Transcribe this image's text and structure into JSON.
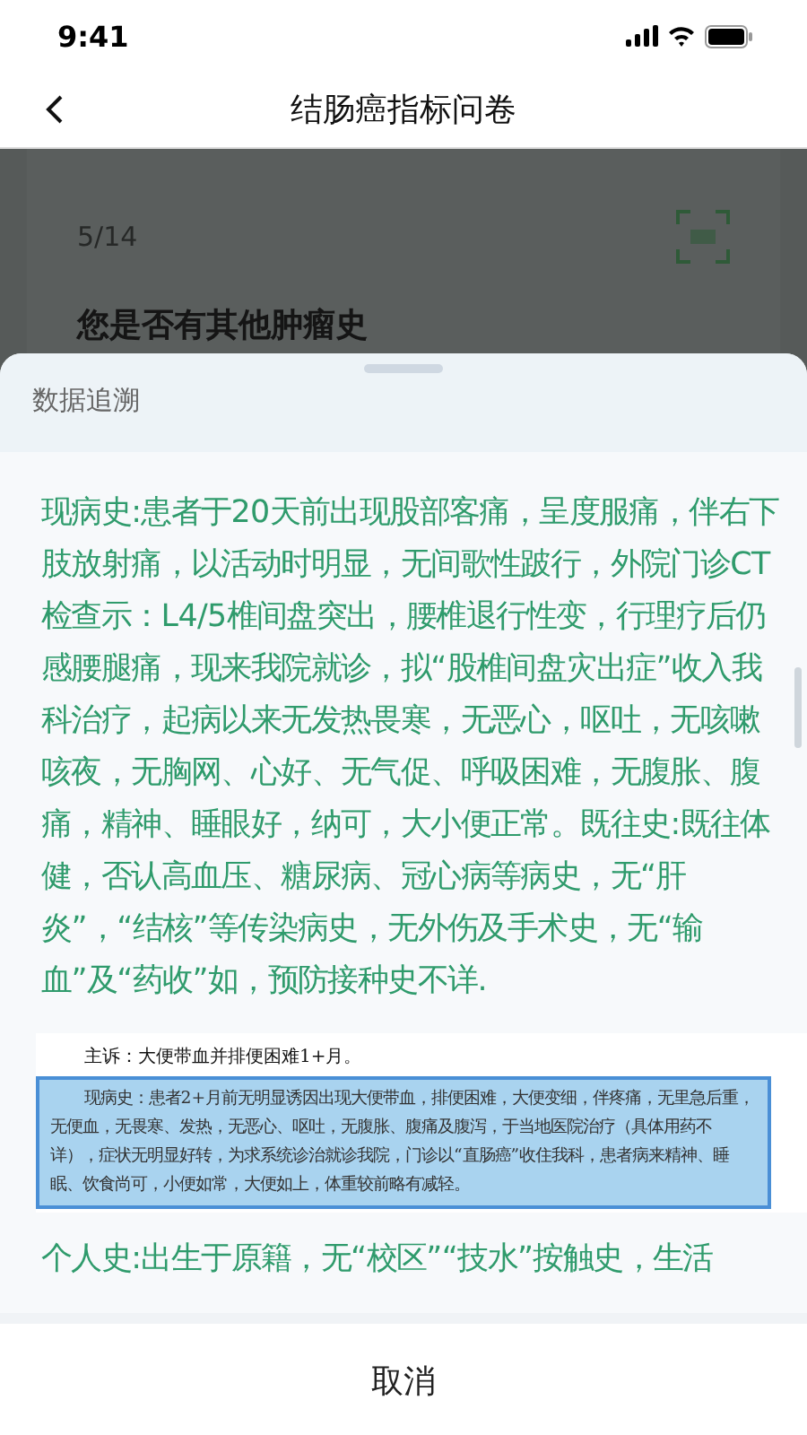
{
  "status_bar": {
    "time": "9:41"
  },
  "nav": {
    "title": "结肠癌指标问卷"
  },
  "question_card": {
    "progress": "5/14",
    "question": "您是否有其他肿瘤史"
  },
  "sheet": {
    "title": "数据追溯",
    "blocks": [
      {
        "kind": "text",
        "text": "现病史:患者于20天前出现股部客痛，呈度服痛，伴右下肢放射痛，以活动时明显，无间歌性跛行，外院门诊CT检查示：L4/5椎间盘突出，腰椎退行性变，行理疗后仍感腰腿痛，现来我院就诊，拟“股椎间盘灾出症”收入我科治疗，起病以来无发热畏寒，无恶心，呕吐，无咳嗽咳夜，无胸网、心好、无气促、呼吸困难，无腹胀、腹痛，精神、睡眼好，纳可，大小便正常。既往史:既往体健，否认高血压、糖尿病、冠心病等病史，无“肝炎”，“结核”等传染病史，无外伤及手术史，无“输血”及“药收”如，预防接种史不详."
      },
      {
        "kind": "document",
        "heading": "主诉：大便带血并排便困难1+月。",
        "highlight": "现病史：患者2+月前无明显诱因出现大便带血，排便困难，大便变细，伴疼痛，无里急后重，无便血，无畏寒、发热，无恶心、呕吐，无腹胀、腹痛及腹泻，于当地医院治疗（具体用药不详），症状无明显好转，为求系统诊治就诊我院，门诊以“直肠癌”收住我科，患者病来精神、睡眠、饮食尚可，小便如常，大便如上，体重较前略有减轻。"
      },
      {
        "kind": "text",
        "text": "个人史:出生于原籍，无“校区”“技水”按触史，生活"
      }
    ],
    "cancel": "取消"
  }
}
